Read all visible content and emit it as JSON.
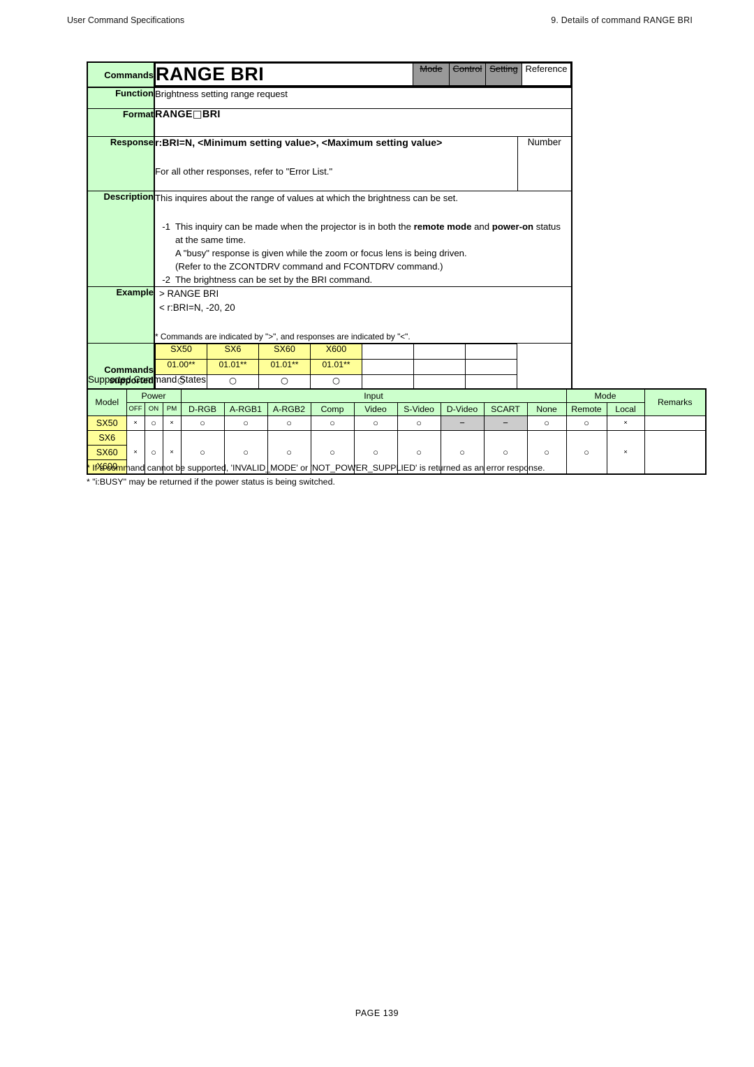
{
  "header": {
    "left": "User Command Specifications",
    "right": "9. Details of command  RANGE BRI"
  },
  "colors": {
    "label_green": "#ccffcc",
    "model_yellow": "#ffff99",
    "disabled_gray": "#999999",
    "cell_gray": "#cccccc"
  },
  "spec": {
    "labels": {
      "commands": "Commands",
      "function": "Function",
      "format": "Format",
      "response": "Response",
      "description": "Description",
      "example": "Example",
      "supported_line1": "Commands",
      "supported_line2": "supported"
    },
    "title": "RANGE BRI",
    "flags": [
      {
        "label": "Mode",
        "struck": true,
        "active": false
      },
      {
        "label": "Control",
        "struck": true,
        "active": false
      },
      {
        "label": "Setting",
        "struck": true,
        "active": false
      },
      {
        "label": "Reference",
        "struck": false,
        "active": true
      }
    ],
    "function_text": "Brightness setting range request",
    "format_text_prefix": "RANGE",
    "format_box_glyph": "□",
    "format_text_suffix": "BRI",
    "response": {
      "signature": "r:BRI=N, <Minimum setting value>, <Maximum setting value>",
      "alternate": "For all other responses, refer to \"Error List.\"",
      "type": "Number"
    },
    "description": {
      "lead": "This inquires about the range of values at which the brightness can be set.",
      "items": [
        {
          "number": "-1",
          "lines": [
            "This inquiry can be made when the projector is in both the remote mode and power-on status",
            "at the same time.",
            "A \"busy\" response is given while the zoom or focus lens is being driven.",
            "(Refer to the ZCONTDRV command and FCONTDRV command.)"
          ],
          "bold_terms": [
            "remote mode",
            "power-on"
          ]
        },
        {
          "number": "-2",
          "lines": [
            "The brightness can be set by the BRI command."
          ],
          "bold_terms": []
        }
      ]
    },
    "example": {
      "lines": [
        "> RANGE BRI",
        "< r:BRI=N, -20, 20"
      ],
      "note": "* Commands are indicated by \">\", and responses are indicated by \"<\"."
    },
    "commands_supported": {
      "models": [
        "SX50",
        "SX6",
        "SX60",
        "X600",
        "",
        "",
        ""
      ],
      "versions": [
        "01.00**",
        "01.01**",
        "01.01**",
        "01.01**",
        "",
        "",
        ""
      ],
      "support": [
        "○",
        "○",
        "○",
        "○",
        "",
        "",
        ""
      ]
    }
  },
  "states": {
    "title": "Supported Command States",
    "groups": {
      "model": "Model",
      "power": "Power",
      "input": "Input",
      "mode": "Mode",
      "remarks": "Remarks"
    },
    "subheaders": {
      "power": [
        "OFF",
        "ON",
        "PM"
      ],
      "input": [
        "D-RGB",
        "A-RGB1",
        "A-RGB2",
        "Comp",
        "Video",
        "S-Video",
        "D-Video",
        "SCART",
        "None"
      ],
      "mode": [
        "Remote",
        "Local"
      ]
    },
    "rows": [
      {
        "models": [
          "SX50"
        ],
        "power": [
          "×",
          "○",
          "×"
        ],
        "input": [
          "○",
          "○",
          "○",
          "○",
          "○",
          "○",
          "−",
          "−",
          "○"
        ],
        "input_gray": [
          false,
          false,
          false,
          false,
          false,
          false,
          true,
          true,
          false
        ],
        "mode": [
          "○",
          "×"
        ],
        "remarks": ""
      },
      {
        "models": [
          "SX6",
          "SX60",
          "X600"
        ],
        "power": [
          "×",
          "○",
          "×"
        ],
        "input": [
          "○",
          "○",
          "○",
          "○",
          "○",
          "○",
          "○",
          "○",
          "○"
        ],
        "input_gray": [
          false,
          false,
          false,
          false,
          false,
          false,
          false,
          false,
          false
        ],
        "mode": [
          "○",
          "×"
        ],
        "remarks": ""
      }
    ]
  },
  "footnotes": [
    "* If a command cannot be supported, 'INVALID_MODE' or 'NOT_POWER_SUPPLIED' is returned as an error response.",
    "* \"i:BUSY\" may be returned if the power status is being switched."
  ],
  "footer": {
    "page_label": "PAGE 139"
  }
}
